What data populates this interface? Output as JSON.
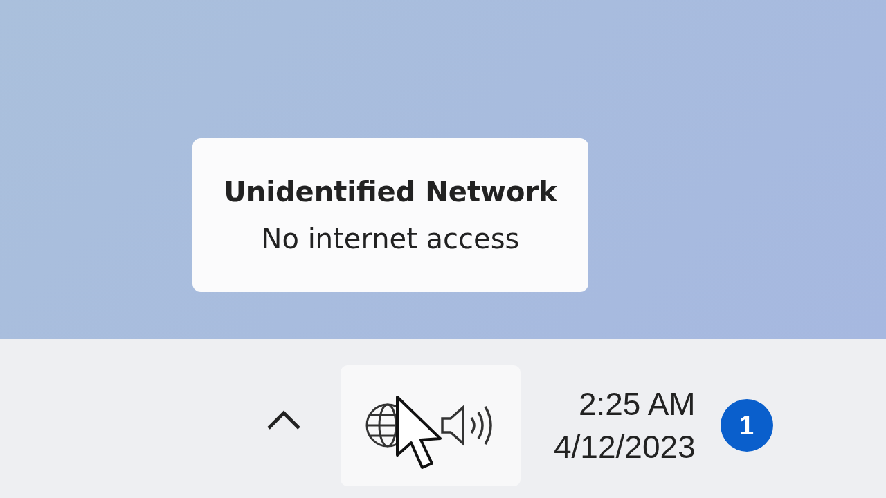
{
  "tooltip": {
    "title": "Unidentified Network",
    "subtitle": "No internet access"
  },
  "taskbar": {
    "time": "2:25 AM",
    "date": "4/12/2023",
    "notification_count": "1"
  }
}
